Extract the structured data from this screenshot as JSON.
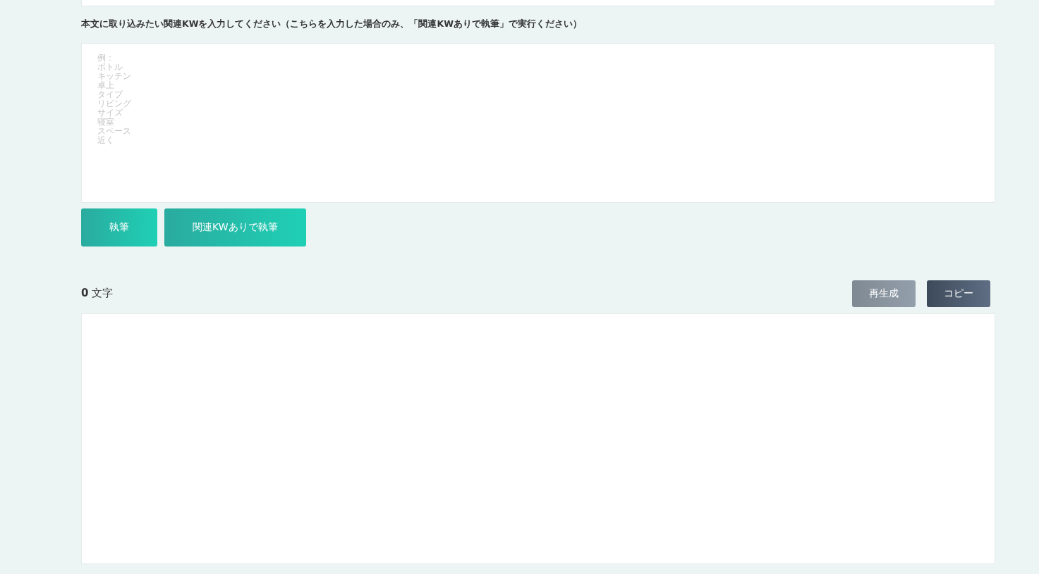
{
  "keyword_prompt": "本文に取り込みたい関連KWを入力してください（こちらを入力した場合のみ、「関連KWありで執筆」で実行ください）",
  "keyword_field": {
    "placeholder": [
      "例：",
      "ボトル",
      "キッチン",
      "卓上",
      "タイプ",
      "リビング",
      "サイズ",
      "寝室",
      "スペース",
      "近く"
    ]
  },
  "write_buttons": [
    {
      "label": "執筆"
    },
    {
      "label": "関連KWありで執筆"
    }
  ],
  "char_count": {
    "value": "0",
    "unit": "文字"
  },
  "output_buttons": [
    {
      "label": "再生成",
      "kind": "muted"
    },
    {
      "label": "コピー",
      "kind": "dark"
    }
  ]
}
